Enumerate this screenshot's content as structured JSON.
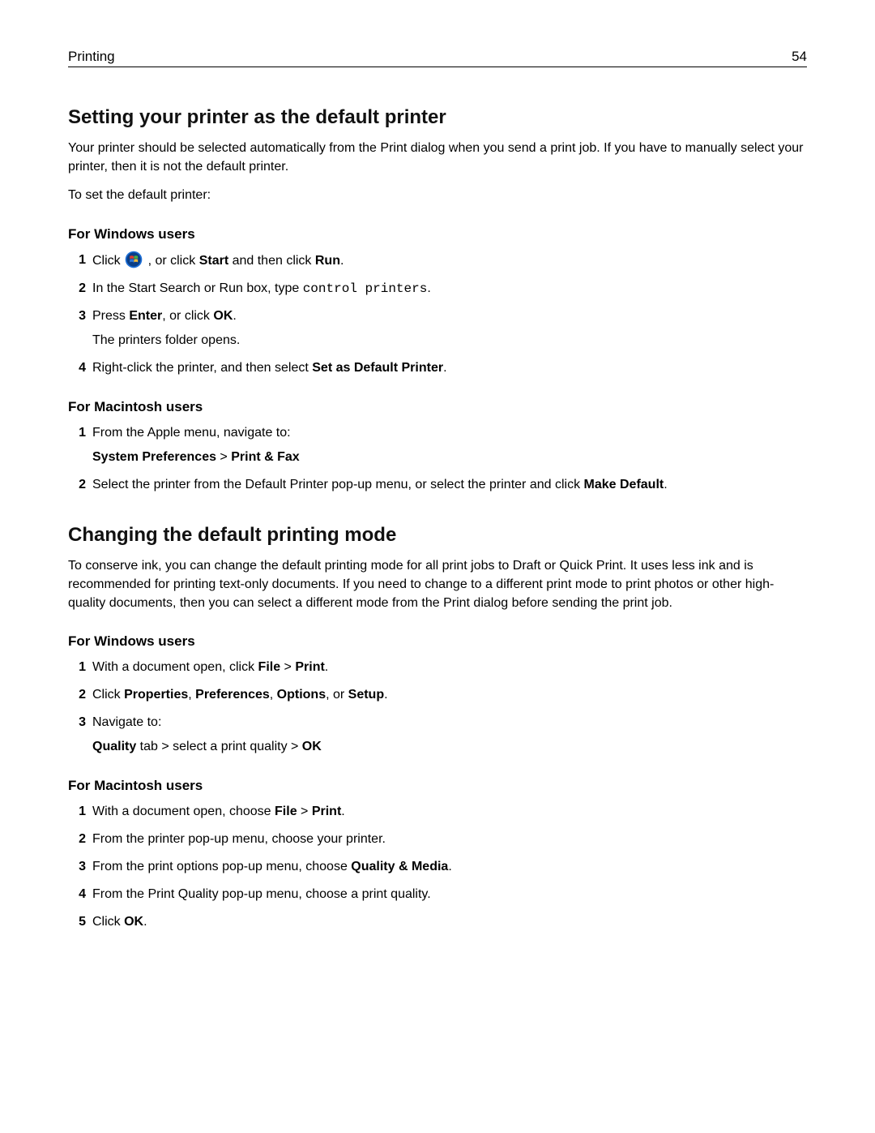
{
  "header": {
    "section": "Printing",
    "page_number": "54"
  },
  "section1": {
    "title": "Setting your printer as the default printer",
    "intro": "Your printer should be selected automatically from the Print dialog when you send a print job. If you have to manually select your printer, then it is not the default printer.",
    "lead": "To set the default printer:",
    "windows": {
      "heading": "For Windows users",
      "step1_pre": "Click ",
      "step1_post": ", or click ",
      "step1_b1": "Start",
      "step1_mid": " and then click ",
      "step1_b2": "Run",
      "step1_end": ".",
      "step2_pre": "In the Start Search or Run box, type ",
      "step2_cmd": "control printers",
      "step2_end": ".",
      "step3_pre": "Press ",
      "step3_b1": "Enter",
      "step3_mid": ", or click ",
      "step3_b2": "OK",
      "step3_end": ".",
      "step3_note": "The printers folder opens.",
      "step4_pre": "Right‑click the printer, and then select ",
      "step4_b1": "Set as Default Printer",
      "step4_end": "."
    },
    "mac": {
      "heading": "For Macintosh users",
      "step1": "From the Apple menu, navigate to:",
      "step1_path_a": "System Preferences",
      "step1_sep": " > ",
      "step1_path_b": "Print & Fax",
      "step2_pre": "Select the printer from the Default Printer pop‑up menu, or select the printer and click ",
      "step2_b1": "Make Default",
      "step2_end": "."
    }
  },
  "section2": {
    "title": "Changing the default printing mode",
    "intro": "To conserve ink, you can change the default printing mode for all print jobs to Draft or Quick Print. It uses less ink and is recommended for printing text-only documents. If you need to change to a different print mode to print photos or other high-quality documents, then you can select a different mode from the Print dialog before sending the print job.",
    "windows": {
      "heading": "For Windows users",
      "step1_pre": "With a document open, click ",
      "step1_b1": "File",
      "step1_mid": " > ",
      "step1_b2": "Print",
      "step1_end": ".",
      "step2_pre": "Click ",
      "step2_b1": "Properties",
      "step2_s1": ", ",
      "step2_b2": "Preferences",
      "step2_s2": ", ",
      "step2_b3": "Options",
      "step2_s3": ", or ",
      "step2_b4": "Setup",
      "step2_end": ".",
      "step3": "Navigate to:",
      "step3_path_b1": "Quality",
      "step3_path_mid": " tab > select a print quality > ",
      "step3_path_b2": "OK"
    },
    "mac": {
      "heading": "For Macintosh users",
      "step1_pre": "With a document open, choose ",
      "step1_b1": "File",
      "step1_mid": " > ",
      "step1_b2": "Print",
      "step1_end": ".",
      "step2": "From the printer pop‑up menu, choose your printer.",
      "step3_pre": "From the print options pop‑up menu, choose ",
      "step3_b1": "Quality & Media",
      "step3_end": ".",
      "step4": "From the Print Quality pop‑up menu, choose a print quality.",
      "step5_pre": "Click ",
      "step5_b1": "OK",
      "step5_end": "."
    }
  }
}
